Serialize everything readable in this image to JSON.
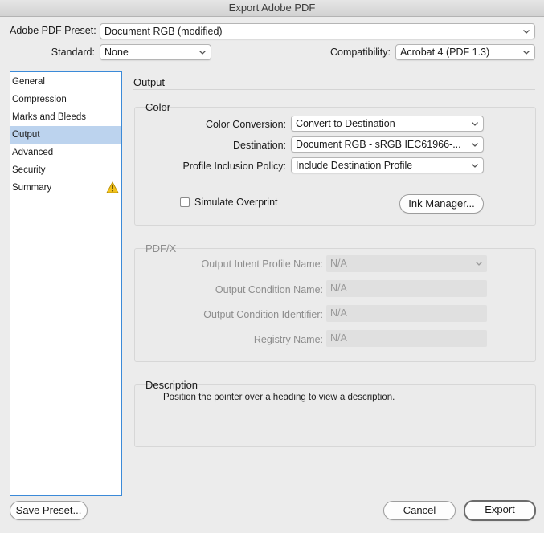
{
  "window": {
    "title": "Export Adobe PDF"
  },
  "preset": {
    "label": "Adobe PDF Preset:",
    "value": "Document RGB (modified)"
  },
  "standard": {
    "label": "Standard:",
    "value": "None"
  },
  "compatibility": {
    "label": "Compatibility:",
    "value": "Acrobat 4 (PDF 1.3)"
  },
  "sidebar": {
    "items": [
      {
        "label": "General"
      },
      {
        "label": "Compression"
      },
      {
        "label": "Marks and Bleeds"
      },
      {
        "label": "Output"
      },
      {
        "label": "Advanced"
      },
      {
        "label": "Security"
      },
      {
        "label": "Summary"
      }
    ],
    "selected": "Output",
    "warning_icon": "warning-triangle-icon"
  },
  "main": {
    "heading": "Output"
  },
  "color": {
    "title": "Color",
    "conversion": {
      "label": "Color Conversion:",
      "value": "Convert to Destination"
    },
    "destination": {
      "label": "Destination:",
      "value": "Document RGB - sRGB IEC61966-..."
    },
    "profile_policy": {
      "label": "Profile Inclusion Policy:",
      "value": "Include Destination Profile"
    },
    "simulate_overprint": {
      "label": "Simulate Overprint",
      "checked": false
    },
    "ink_manager": "Ink Manager..."
  },
  "pdfx": {
    "title": "PDF/X",
    "intent_profile": {
      "label": "Output Intent Profile Name:",
      "value": "N/A"
    },
    "condition_name": {
      "label": "Output Condition Name:",
      "value": "N/A"
    },
    "condition_identifier": {
      "label": "Output Condition Identifier:",
      "value": "N/A"
    },
    "registry_name": {
      "label": "Registry Name:",
      "value": "N/A"
    }
  },
  "description": {
    "title": "Description",
    "text": "Position the pointer over a heading to view a description."
  },
  "footer": {
    "save_preset": "Save Preset...",
    "cancel": "Cancel",
    "export": "Export"
  },
  "colors": {
    "selection": "#bcd3ee",
    "focus_border": "#3b8ad8",
    "warning": "#f2c21b"
  }
}
